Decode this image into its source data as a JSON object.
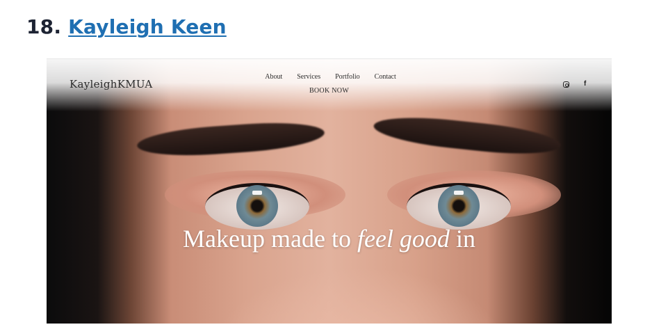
{
  "heading": {
    "number": "18.",
    "link_text": "Kayleigh Keen"
  },
  "site": {
    "logo": "KayleighKMUA",
    "nav": {
      "links": [
        "About",
        "Services",
        "Portfolio",
        "Contact"
      ],
      "book": "BOOK NOW"
    },
    "social": {
      "instagram_icon": "instagram-icon",
      "facebook_icon": "facebook-icon",
      "facebook_glyph": "f"
    },
    "hero": {
      "text_before": "Makeup made to ",
      "text_italic": "feel good",
      "text_after": " in"
    }
  },
  "colors": {
    "heading_text": "#1d2333",
    "link": "#1f6fb2",
    "hero_text": "#ffffff"
  }
}
